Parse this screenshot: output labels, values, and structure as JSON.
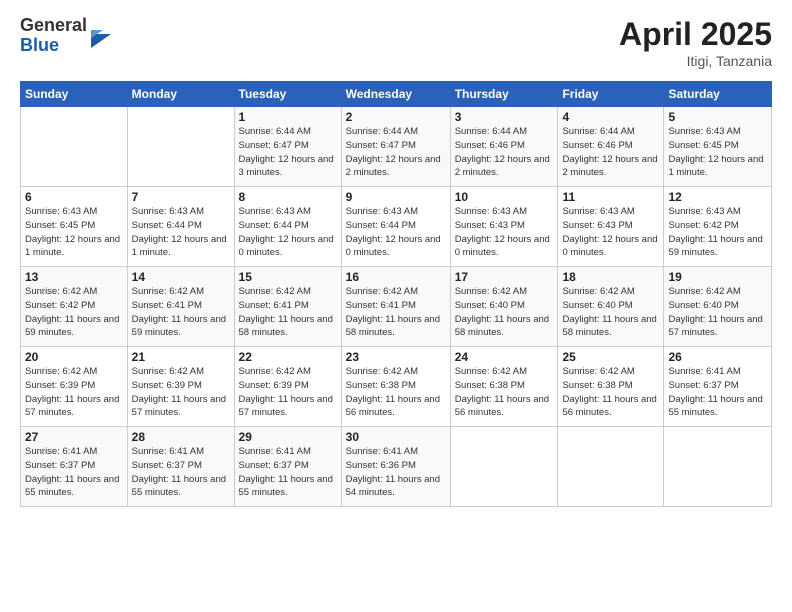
{
  "logo": {
    "general": "General",
    "blue": "Blue"
  },
  "title": {
    "month": "April 2025",
    "location": "Itigi, Tanzania"
  },
  "weekdays": [
    "Sunday",
    "Monday",
    "Tuesday",
    "Wednesday",
    "Thursday",
    "Friday",
    "Saturday"
  ],
  "weeks": [
    [
      {
        "day": "",
        "sunrise": "",
        "sunset": "",
        "daylight": ""
      },
      {
        "day": "",
        "sunrise": "",
        "sunset": "",
        "daylight": ""
      },
      {
        "day": "1",
        "sunrise": "Sunrise: 6:44 AM",
        "sunset": "Sunset: 6:47 PM",
        "daylight": "Daylight: 12 hours and 3 minutes."
      },
      {
        "day": "2",
        "sunrise": "Sunrise: 6:44 AM",
        "sunset": "Sunset: 6:47 PM",
        "daylight": "Daylight: 12 hours and 2 minutes."
      },
      {
        "day": "3",
        "sunrise": "Sunrise: 6:44 AM",
        "sunset": "Sunset: 6:46 PM",
        "daylight": "Daylight: 12 hours and 2 minutes."
      },
      {
        "day": "4",
        "sunrise": "Sunrise: 6:44 AM",
        "sunset": "Sunset: 6:46 PM",
        "daylight": "Daylight: 12 hours and 2 minutes."
      },
      {
        "day": "5",
        "sunrise": "Sunrise: 6:43 AM",
        "sunset": "Sunset: 6:45 PM",
        "daylight": "Daylight: 12 hours and 1 minute."
      }
    ],
    [
      {
        "day": "6",
        "sunrise": "Sunrise: 6:43 AM",
        "sunset": "Sunset: 6:45 PM",
        "daylight": "Daylight: 12 hours and 1 minute."
      },
      {
        "day": "7",
        "sunrise": "Sunrise: 6:43 AM",
        "sunset": "Sunset: 6:44 PM",
        "daylight": "Daylight: 12 hours and 1 minute."
      },
      {
        "day": "8",
        "sunrise": "Sunrise: 6:43 AM",
        "sunset": "Sunset: 6:44 PM",
        "daylight": "Daylight: 12 hours and 0 minutes."
      },
      {
        "day": "9",
        "sunrise": "Sunrise: 6:43 AM",
        "sunset": "Sunset: 6:44 PM",
        "daylight": "Daylight: 12 hours and 0 minutes."
      },
      {
        "day": "10",
        "sunrise": "Sunrise: 6:43 AM",
        "sunset": "Sunset: 6:43 PM",
        "daylight": "Daylight: 12 hours and 0 minutes."
      },
      {
        "day": "11",
        "sunrise": "Sunrise: 6:43 AM",
        "sunset": "Sunset: 6:43 PM",
        "daylight": "Daylight: 12 hours and 0 minutes."
      },
      {
        "day": "12",
        "sunrise": "Sunrise: 6:43 AM",
        "sunset": "Sunset: 6:42 PM",
        "daylight": "Daylight: 11 hours and 59 minutes."
      }
    ],
    [
      {
        "day": "13",
        "sunrise": "Sunrise: 6:42 AM",
        "sunset": "Sunset: 6:42 PM",
        "daylight": "Daylight: 11 hours and 59 minutes."
      },
      {
        "day": "14",
        "sunrise": "Sunrise: 6:42 AM",
        "sunset": "Sunset: 6:41 PM",
        "daylight": "Daylight: 11 hours and 59 minutes."
      },
      {
        "day": "15",
        "sunrise": "Sunrise: 6:42 AM",
        "sunset": "Sunset: 6:41 PM",
        "daylight": "Daylight: 11 hours and 58 minutes."
      },
      {
        "day": "16",
        "sunrise": "Sunrise: 6:42 AM",
        "sunset": "Sunset: 6:41 PM",
        "daylight": "Daylight: 11 hours and 58 minutes."
      },
      {
        "day": "17",
        "sunrise": "Sunrise: 6:42 AM",
        "sunset": "Sunset: 6:40 PM",
        "daylight": "Daylight: 11 hours and 58 minutes."
      },
      {
        "day": "18",
        "sunrise": "Sunrise: 6:42 AM",
        "sunset": "Sunset: 6:40 PM",
        "daylight": "Daylight: 11 hours and 58 minutes."
      },
      {
        "day": "19",
        "sunrise": "Sunrise: 6:42 AM",
        "sunset": "Sunset: 6:40 PM",
        "daylight": "Daylight: 11 hours and 57 minutes."
      }
    ],
    [
      {
        "day": "20",
        "sunrise": "Sunrise: 6:42 AM",
        "sunset": "Sunset: 6:39 PM",
        "daylight": "Daylight: 11 hours and 57 minutes."
      },
      {
        "day": "21",
        "sunrise": "Sunrise: 6:42 AM",
        "sunset": "Sunset: 6:39 PM",
        "daylight": "Daylight: 11 hours and 57 minutes."
      },
      {
        "day": "22",
        "sunrise": "Sunrise: 6:42 AM",
        "sunset": "Sunset: 6:39 PM",
        "daylight": "Daylight: 11 hours and 57 minutes."
      },
      {
        "day": "23",
        "sunrise": "Sunrise: 6:42 AM",
        "sunset": "Sunset: 6:38 PM",
        "daylight": "Daylight: 11 hours and 56 minutes."
      },
      {
        "day": "24",
        "sunrise": "Sunrise: 6:42 AM",
        "sunset": "Sunset: 6:38 PM",
        "daylight": "Daylight: 11 hours and 56 minutes."
      },
      {
        "day": "25",
        "sunrise": "Sunrise: 6:42 AM",
        "sunset": "Sunset: 6:38 PM",
        "daylight": "Daylight: 11 hours and 56 minutes."
      },
      {
        "day": "26",
        "sunrise": "Sunrise: 6:41 AM",
        "sunset": "Sunset: 6:37 PM",
        "daylight": "Daylight: 11 hours and 55 minutes."
      }
    ],
    [
      {
        "day": "27",
        "sunrise": "Sunrise: 6:41 AM",
        "sunset": "Sunset: 6:37 PM",
        "daylight": "Daylight: 11 hours and 55 minutes."
      },
      {
        "day": "28",
        "sunrise": "Sunrise: 6:41 AM",
        "sunset": "Sunset: 6:37 PM",
        "daylight": "Daylight: 11 hours and 55 minutes."
      },
      {
        "day": "29",
        "sunrise": "Sunrise: 6:41 AM",
        "sunset": "Sunset: 6:37 PM",
        "daylight": "Daylight: 11 hours and 55 minutes."
      },
      {
        "day": "30",
        "sunrise": "Sunrise: 6:41 AM",
        "sunset": "Sunset: 6:36 PM",
        "daylight": "Daylight: 11 hours and 54 minutes."
      },
      {
        "day": "",
        "sunrise": "",
        "sunset": "",
        "daylight": ""
      },
      {
        "day": "",
        "sunrise": "",
        "sunset": "",
        "daylight": ""
      },
      {
        "day": "",
        "sunrise": "",
        "sunset": "",
        "daylight": ""
      }
    ]
  ]
}
